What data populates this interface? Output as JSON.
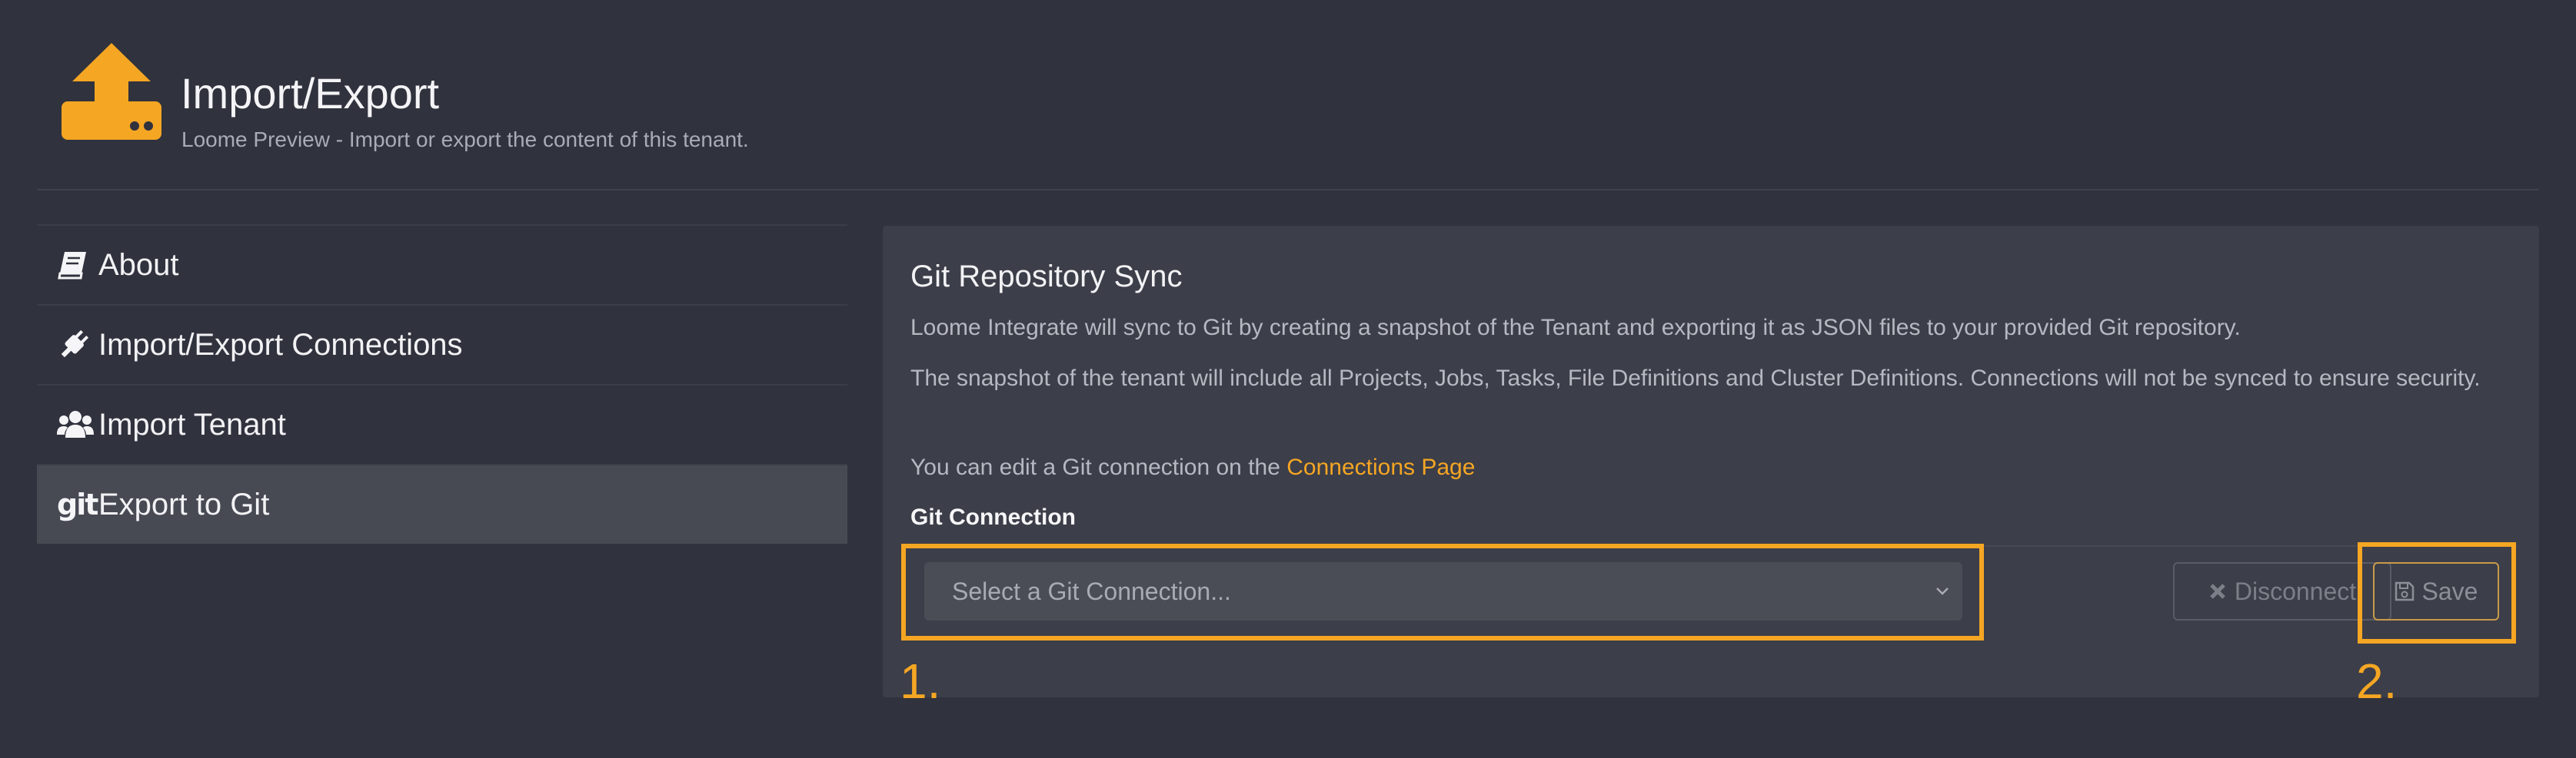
{
  "header": {
    "title": "Import/Export",
    "subtitle": "Loome Preview - Import or export the content of this tenant.",
    "icon": "upload-drive-icon",
    "accent_color": "#f5a623"
  },
  "sidebar": {
    "items": [
      {
        "label": "About",
        "icon": "book-icon",
        "active": false
      },
      {
        "label": "Import/Export Connections",
        "icon": "plug-icon",
        "active": false
      },
      {
        "label": "Import Tenant",
        "icon": "users-icon",
        "active": false
      },
      {
        "label": "Export to Git",
        "icon": "git-icon",
        "active": true
      }
    ]
  },
  "main": {
    "title": "Git Repository Sync",
    "paragraph1": "Loome Integrate will sync to Git by creating a snapshot of the Tenant and exporting it as JSON files to your provided Git repository.",
    "paragraph2": "The snapshot of the tenant will include all Projects, Jobs, Tasks, File Definitions and Cluster Definitions. Connections will not be synced to ensure security.",
    "paragraph3_prefix": "You can edit a Git connection on the ",
    "connections_link": "Connections Page",
    "git_connection_label": "Git Connection",
    "select_placeholder": "Select a Git Connection...",
    "disconnect_label": "Disconnect",
    "save_label": "Save",
    "step1": "1.",
    "step2": "2."
  }
}
